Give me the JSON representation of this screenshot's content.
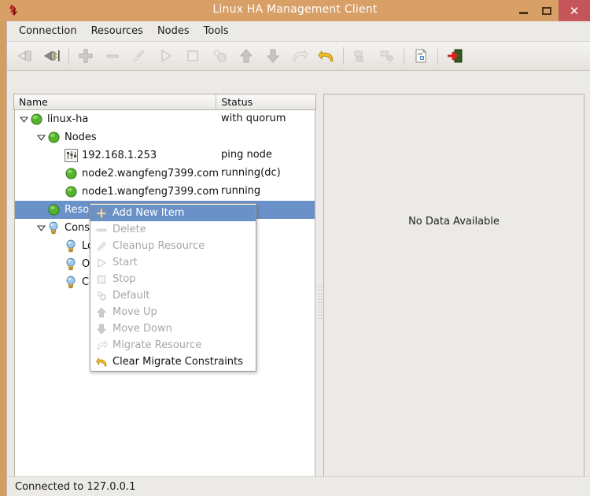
{
  "window": {
    "title": "Linux HA Management Client",
    "app_icon": "app-logo-icon",
    "controls": {
      "minimize": "minimize-icon",
      "maximize": "maximize-icon",
      "close": "✕"
    }
  },
  "menubar": {
    "items": [
      {
        "label": "Connection"
      },
      {
        "label": "Resources"
      },
      {
        "label": "Nodes"
      },
      {
        "label": "Tools"
      }
    ]
  },
  "toolbar": {
    "buttons": [
      {
        "name": "disconnect-icon",
        "enabled": false
      },
      {
        "name": "connect-icon",
        "enabled": true
      },
      {
        "name": "separator",
        "enabled": false
      },
      {
        "name": "add-icon",
        "enabled": true
      },
      {
        "name": "remove-icon",
        "enabled": false
      },
      {
        "name": "cleanup-broom-icon",
        "enabled": false
      },
      {
        "name": "start-play-icon",
        "enabled": false
      },
      {
        "name": "stop-square-icon",
        "enabled": false
      },
      {
        "name": "default-gears-icon",
        "enabled": false
      },
      {
        "name": "move-up-arrow-icon",
        "enabled": true
      },
      {
        "name": "move-down-arrow-icon",
        "enabled": true
      },
      {
        "name": "migrate-resource-icon",
        "enabled": false
      },
      {
        "name": "clear-migrate-constraints-icon",
        "enabled": true
      },
      {
        "name": "separator",
        "enabled": false
      },
      {
        "name": "standby-icon",
        "enabled": false
      },
      {
        "name": "node-action-icon",
        "enabled": false
      },
      {
        "name": "separator",
        "enabled": false
      },
      {
        "name": "cib-document-icon",
        "enabled": true
      },
      {
        "name": "separator",
        "enabled": false
      },
      {
        "name": "exit-icon",
        "enabled": true
      }
    ]
  },
  "tree": {
    "columns": [
      {
        "key": "name",
        "label": "Name"
      },
      {
        "key": "status",
        "label": "Status"
      }
    ],
    "rows": [
      {
        "label": "linux-ha",
        "status": "with quorum",
        "icon": "green-ball-icon",
        "indent": 0,
        "twisty": "expanded",
        "selected": false
      },
      {
        "label": "Nodes",
        "status": "",
        "icon": "green-ball-icon",
        "indent": 1,
        "twisty": "expanded",
        "selected": false
      },
      {
        "label": "192.168.1.253",
        "status": "ping node",
        "icon": "ping-node-icon",
        "indent": 2,
        "twisty": "none",
        "selected": false
      },
      {
        "label": "node2.wangfeng7399.com",
        "status": "running(dc)",
        "icon": "green-ball-icon",
        "indent": 2,
        "twisty": "none",
        "selected": false
      },
      {
        "label": "node1.wangfeng7399.com",
        "status": "running",
        "icon": "green-ball-icon",
        "indent": 2,
        "twisty": "none",
        "selected": false
      },
      {
        "label": "Resources",
        "status": "",
        "icon": "green-ball-icon",
        "indent": 1,
        "twisty": "none",
        "selected": true
      },
      {
        "label": "Constraints",
        "status": "",
        "icon": "bulb-icon",
        "indent": 1,
        "twisty": "expanded",
        "selected": false
      },
      {
        "label": "Locations",
        "status": "",
        "icon": "bulb-icon",
        "indent": 2,
        "twisty": "none",
        "selected": false
      },
      {
        "label": "Orders",
        "status": "",
        "icon": "bulb-icon",
        "indent": 2,
        "twisty": "none",
        "selected": false
      },
      {
        "label": "Colocations",
        "status": "",
        "icon": "bulb-icon",
        "indent": 2,
        "twisty": "none",
        "selected": false
      }
    ]
  },
  "context_menu": {
    "items": [
      {
        "label": "Add New Item",
        "icon": "plus-icon",
        "state": "highlight"
      },
      {
        "label": "Delete",
        "icon": "minus-icon",
        "state": "disabled"
      },
      {
        "label": "Cleanup Resource",
        "icon": "broom-icon",
        "state": "disabled"
      },
      {
        "label": "Start",
        "icon": "play-icon",
        "state": "disabled"
      },
      {
        "label": "Stop",
        "icon": "stop-icon",
        "state": "disabled"
      },
      {
        "label": "Default",
        "icon": "gears-icon",
        "state": "disabled"
      },
      {
        "label": "Move Up",
        "icon": "arrow-up-icon",
        "state": "disabled"
      },
      {
        "label": "Move Down",
        "icon": "arrow-down-icon",
        "state": "disabled"
      },
      {
        "label": "Migrate Resource",
        "icon": "migrate-arrow-icon",
        "state": "disabled"
      },
      {
        "label": "Clear Migrate Constraints",
        "icon": "undo-arrow-icon",
        "state": "enabled"
      }
    ]
  },
  "right_panel": {
    "empty_text": "No Data Available"
  },
  "statusbar": {
    "text": "Connected to 127.0.0.1"
  },
  "colors": {
    "title_bar": "#d89f66",
    "close_button": "#c6555a",
    "selection": "#6a91c8",
    "panel_bg": "#eceae6",
    "node_green": "#5cb13a"
  }
}
